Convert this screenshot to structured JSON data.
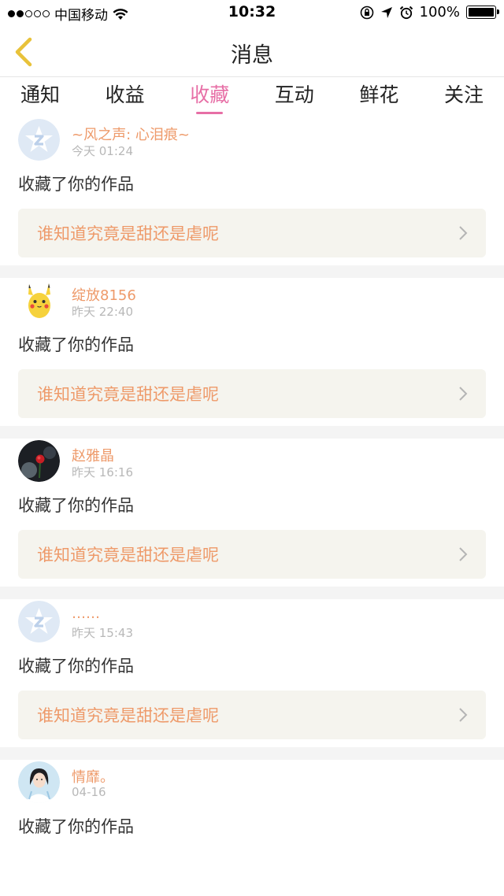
{
  "status_bar": {
    "carrier": "中国移动",
    "time": "10:32",
    "battery": "100%",
    "signal_icons": "signal-dots-icon",
    "battery_level": 1.0
  },
  "nav": {
    "title": "消息",
    "back_icon": "chevron-left-icon",
    "back_color": "#e8c23a"
  },
  "tabs": [
    {
      "label": "通知"
    },
    {
      "label": "收益"
    },
    {
      "label": "收藏"
    },
    {
      "label": "互动"
    },
    {
      "label": "鲜花"
    },
    {
      "label": "关注"
    }
  ],
  "active_tab": "收藏",
  "colors": {
    "accent": "#e76fa6",
    "name": "#ee9a6a",
    "work_bg": "#f5f4ee"
  },
  "feed": [
    {
      "name": "~风之声: 心泪痕~",
      "time": "今天 01:24",
      "action": "收藏了你的作品",
      "work": "谁知道究竟是甜还是虐呢",
      "avatar": "default-avatar-icon"
    },
    {
      "name": "绽放8156",
      "time": "昨天 22:40",
      "action": "收藏了你的作品",
      "work": "谁知道究竟是甜还是虐呢",
      "avatar": "pikachu-avatar"
    },
    {
      "name": "赵雅晶",
      "time": "昨天 16:16",
      "action": "收藏了你的作品",
      "work": "谁知道究竟是甜还是虐呢",
      "avatar": "rose-avatar"
    },
    {
      "name": "……",
      "time": "昨天 15:43",
      "action": "收藏了你的作品",
      "work": "谁知道究竟是甜还是虐呢",
      "avatar": "default-avatar-icon"
    },
    {
      "name": "情靡。",
      "time": "04-16",
      "action": "收藏了你的作品",
      "work": "",
      "avatar": "girl-avatar"
    }
  ]
}
